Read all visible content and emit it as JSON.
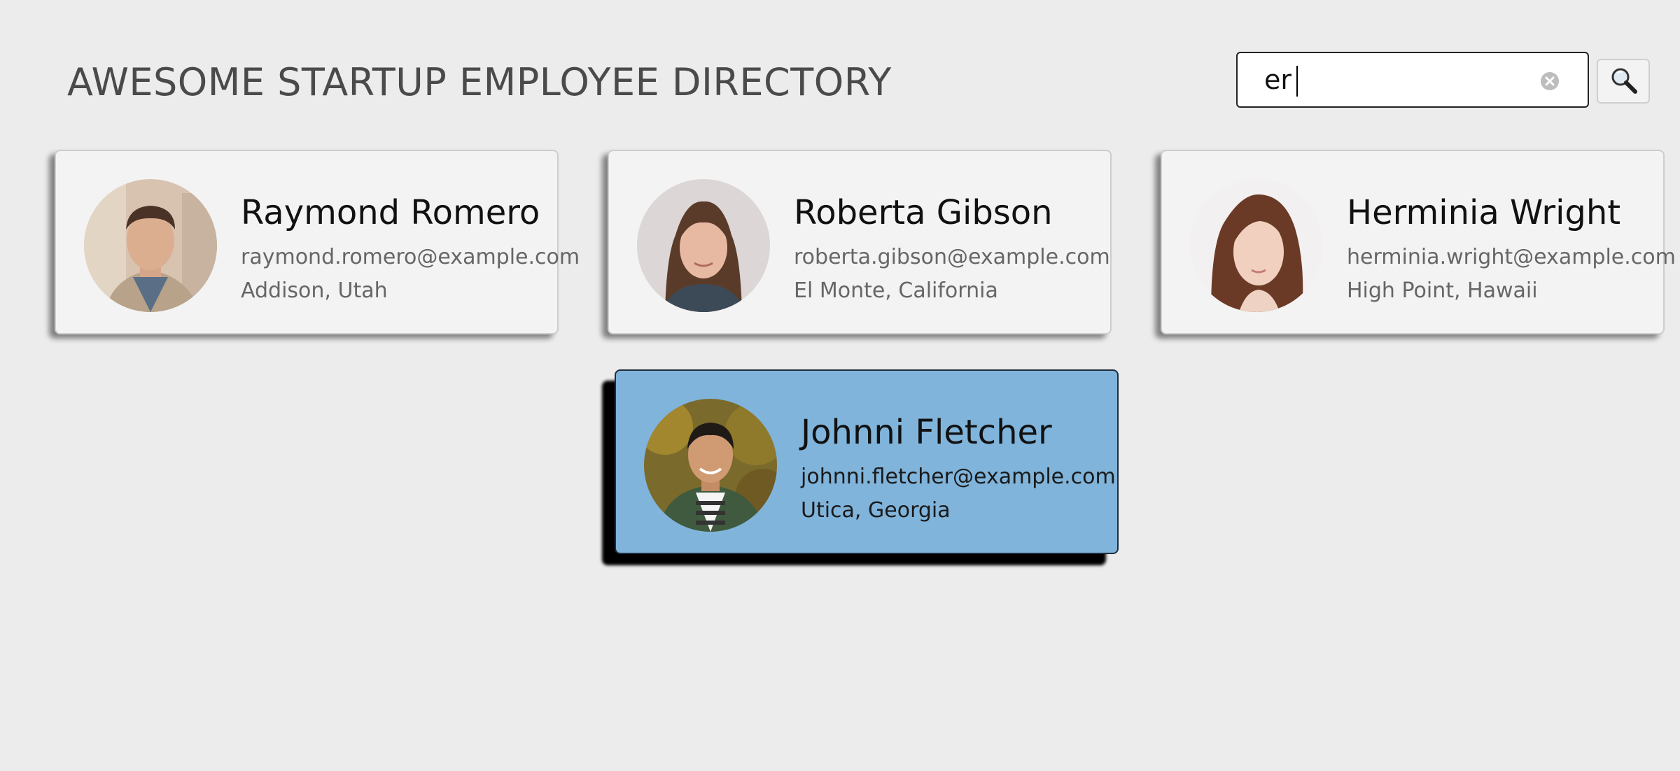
{
  "header": {
    "title": "AWESOME STARTUP EMPLOYEE DIRECTORY"
  },
  "search": {
    "value": "er",
    "clear_icon": "clear-icon",
    "button_icon": "magnifier-icon"
  },
  "employees": [
    {
      "name": "Raymond Romero",
      "email": "raymond.romero@example.com",
      "location": "Addison, Utah",
      "selected": false
    },
    {
      "name": "Roberta Gibson",
      "email": "roberta.gibson@example.com",
      "location": "El Monte, California",
      "selected": false
    },
    {
      "name": "Herminia Wright",
      "email": "herminia.wright@example.com",
      "location": "High Point, Hawaii",
      "selected": false
    },
    {
      "name": "Johnni Fletcher",
      "email": "johnni.fletcher@example.com",
      "location": "Utica, Georgia",
      "selected": true
    }
  ],
  "colors": {
    "background": "#ececec",
    "card": "#f3f3f3",
    "selected_card": "#80b4db",
    "title": "#4a4a4a"
  }
}
